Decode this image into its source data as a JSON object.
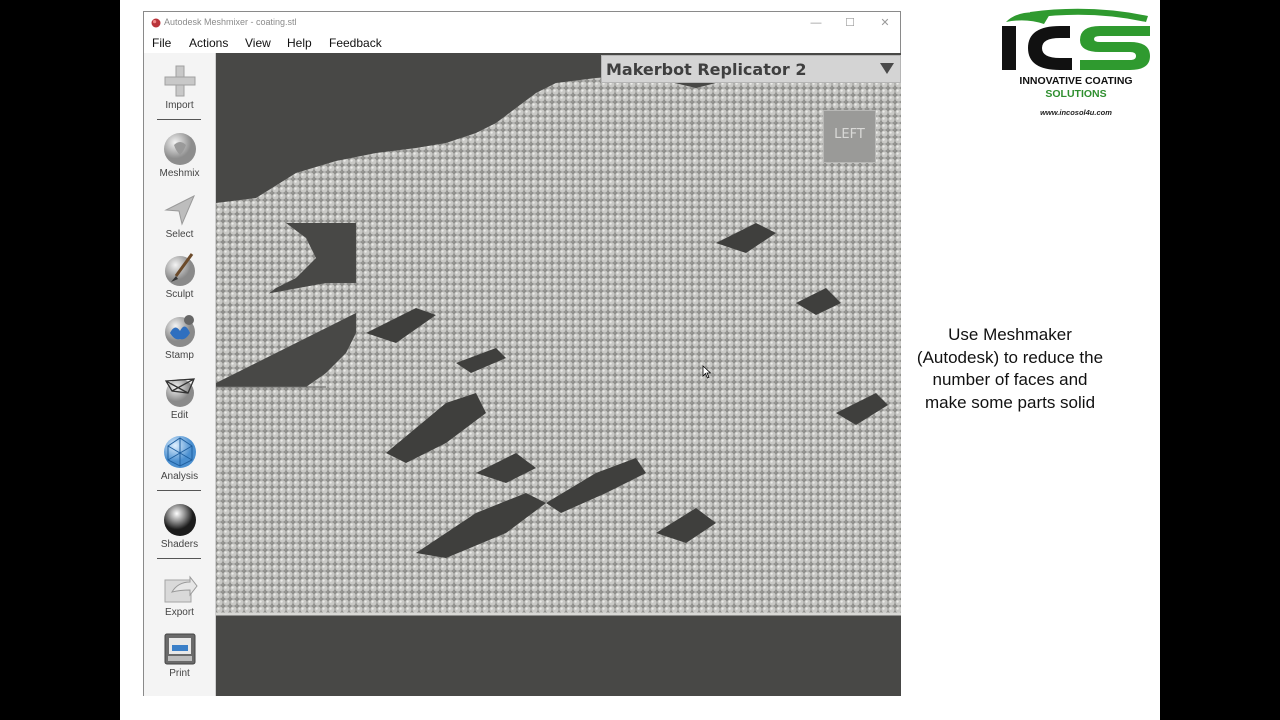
{
  "window": {
    "title": "Autodesk Meshmixer - coating.stl",
    "controls": {
      "minimize": "—",
      "maximize": "☐",
      "close": "✕"
    }
  },
  "menu": [
    "File",
    "Actions",
    "View",
    "Help",
    "Feedback"
  ],
  "toolbar": {
    "tools": [
      {
        "label": "Import",
        "icon": "plus-icon"
      },
      {
        "label": "Meshmix",
        "icon": "bunny-sphere-icon"
      },
      {
        "label": "Select",
        "icon": "arrow-pointer-icon"
      },
      {
        "label": "Sculpt",
        "icon": "brush-sphere-icon"
      },
      {
        "label": "Stamp",
        "icon": "stamp-sphere-icon"
      },
      {
        "label": "Edit",
        "icon": "wireframe-sphere-icon"
      },
      {
        "label": "Analysis",
        "icon": "mesh-sphere-icon"
      },
      {
        "label": "Shaders",
        "icon": "chrome-sphere-icon"
      },
      {
        "label": "Export",
        "icon": "export-icon"
      },
      {
        "label": "Print",
        "icon": "printer-icon"
      }
    ]
  },
  "viewport": {
    "printer": "Makerbot Replicator 2",
    "viewcube_label": "LEFT",
    "background_color": "#484846",
    "model_color": "#c9c9c6"
  },
  "caption": "Use Meshmaker (Autodesk) to reduce the number of faces and make some parts solid",
  "logo": {
    "mark": "ICS",
    "line1": "INNOVATIVE COATING",
    "line2": "SOLUTIONS",
    "url": "www.incosol4u.com",
    "colors": {
      "dark": "#111111",
      "green": "#2f9a2f"
    }
  }
}
